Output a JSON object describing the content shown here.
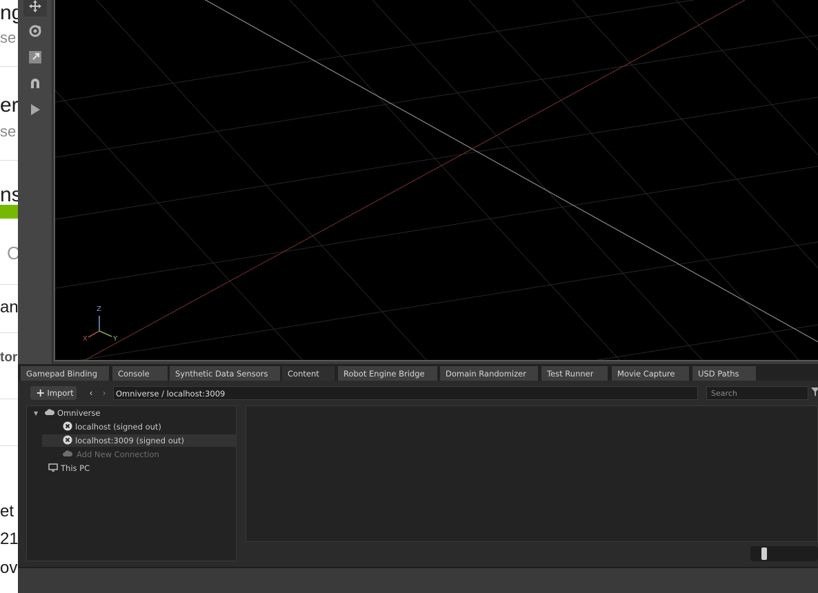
{
  "background_page": {
    "fragments": [
      "ng",
      "se",
      "err",
      "se",
      "ns",
      "C",
      "an",
      "tor",
      "et",
      "21",
      "ovi"
    ]
  },
  "viewport": {
    "axis_labels": {
      "z": "Z",
      "x": "X",
      "y": "Y"
    },
    "axis_colors": {
      "z": "#6fa0d8",
      "x": "#c05050",
      "y": "#8ec05a"
    }
  },
  "toolbar_icons": [
    "move-icon",
    "rotate-icon",
    "scale-icon",
    "snap-magnet-icon",
    "play-icon"
  ],
  "tabs": [
    {
      "label": "Gamepad Binding"
    },
    {
      "label": "Console"
    },
    {
      "label": "Synthetic Data Sensors"
    },
    {
      "label": "Content",
      "active": true
    },
    {
      "label": "Robot Engine Bridge"
    },
    {
      "label": "Domain Randomizer"
    },
    {
      "label": "Test Runner"
    },
    {
      "label": "Movie Capture"
    },
    {
      "label": "USD Paths"
    }
  ],
  "content_toolbar": {
    "import_label": "Import",
    "path": "Omniverse / localhost:3009",
    "search_placeholder": "Search"
  },
  "tree": {
    "omniverse": "Omniverse",
    "localhost": "localhost (signed out)",
    "localhost3009": "localhost:3009 (signed out)",
    "add_connection": "Add New Connection",
    "this_pc": "This PC"
  },
  "colors": {
    "brand_green": "#76b900",
    "viewport_bg": "#000000",
    "panel_bg": "#2b2b2b"
  }
}
